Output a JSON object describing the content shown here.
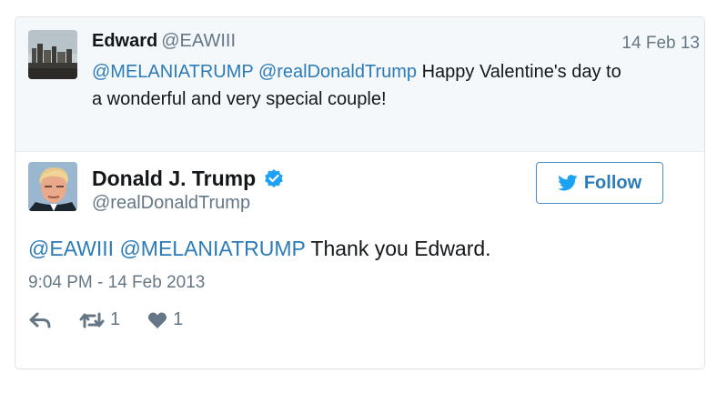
{
  "parent_tweet": {
    "name": "Edward",
    "handle": "@EAWIII",
    "date": "14 Feb 13",
    "mentions": [
      "@MELANIATRUMP",
      "@realDonaldTrump"
    ],
    "text_line1_rest": "Happy Valentine's day to",
    "text_line2": "a wonderful and very special couple!"
  },
  "main_tweet": {
    "name": "Donald J. Trump",
    "handle": "@realDonaldTrump",
    "verified": true,
    "follow_label": "Follow",
    "mentions": [
      "@EAWIII",
      "@MELANIATRUMP"
    ],
    "text_rest": "Thank you Edward.",
    "timestamp": "9:04 PM - 14 Feb 2013",
    "retweet_count": "1",
    "like_count": "1"
  },
  "colors": {
    "link": "#2b7bb9",
    "muted": "#657786",
    "verified": "#1da1f2",
    "parent_bg": "#f5f8fa"
  },
  "icons": [
    "reply-icon",
    "retweet-icon",
    "heart-icon",
    "twitter-bird-icon",
    "verified-badge-icon"
  ]
}
